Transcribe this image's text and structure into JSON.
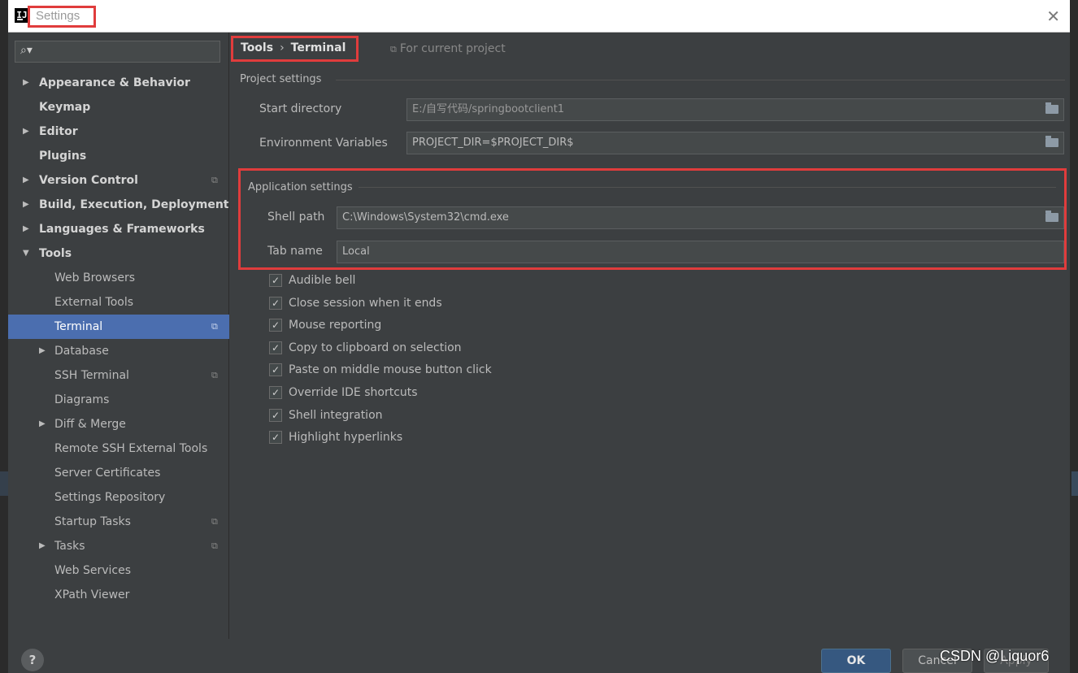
{
  "window": {
    "title": "Settings",
    "app_icon": "IJ",
    "close_symbol": "✕"
  },
  "search": {
    "icon": "⌕▾"
  },
  "sidebar": {
    "items": [
      {
        "label": "Appearance & Behavior",
        "arrow": "▶",
        "bold": true
      },
      {
        "label": "Keymap",
        "arrow": "",
        "bold": true
      },
      {
        "label": "Editor",
        "arrow": "▶",
        "bold": true
      },
      {
        "label": "Plugins",
        "arrow": "",
        "bold": true
      },
      {
        "label": "Version Control",
        "arrow": "▶",
        "bold": true,
        "copy_icon": true
      },
      {
        "label": "Build, Execution, Deployment",
        "arrow": "▶",
        "bold": true
      },
      {
        "label": "Languages & Frameworks",
        "arrow": "▶",
        "bold": true
      },
      {
        "label": "Tools",
        "arrow": "▼",
        "bold": true
      },
      {
        "label": "Web Browsers",
        "arrow": "",
        "bold": false
      },
      {
        "label": "External Tools",
        "arrow": "",
        "bold": false
      },
      {
        "label": "Terminal",
        "arrow": "",
        "bold": false,
        "copy_icon": true,
        "selected": true
      },
      {
        "label": "Database",
        "arrow": "▶",
        "bold": false
      },
      {
        "label": "SSH Terminal",
        "arrow": "",
        "bold": false,
        "copy_icon": true
      },
      {
        "label": "Diagrams",
        "arrow": "",
        "bold": false
      },
      {
        "label": "Diff & Merge",
        "arrow": "▶",
        "bold": false
      },
      {
        "label": "Remote SSH External Tools",
        "arrow": "",
        "bold": false
      },
      {
        "label": "Server Certificates",
        "arrow": "",
        "bold": false
      },
      {
        "label": "Settings Repository",
        "arrow": "",
        "bold": false
      },
      {
        "label": "Startup Tasks",
        "arrow": "",
        "bold": false,
        "copy_icon": true
      },
      {
        "label": "Tasks",
        "arrow": "▶",
        "bold": false,
        "copy_icon": true
      },
      {
        "label": "Web Services",
        "arrow": "",
        "bold": false
      },
      {
        "label": "XPath Viewer",
        "arrow": "",
        "bold": false
      }
    ],
    "copy_icon_glyph": "⧉"
  },
  "breadcrumb": {
    "parent": "Tools",
    "separator": "›",
    "current": "Terminal"
  },
  "scope": {
    "label": "For current project",
    "icon": "⧉"
  },
  "project_settings": {
    "title": "Project settings",
    "start_directory": {
      "label": "Start directory",
      "value": "E:/自写代码/springbootclient1"
    },
    "env_vars": {
      "label": "Environment Variables",
      "value": "PROJECT_DIR=$PROJECT_DIR$"
    }
  },
  "application_settings": {
    "title": "Application settings",
    "shell_path": {
      "label": "Shell path",
      "value": "C:\\Windows\\System32\\cmd.exe"
    },
    "tab_name": {
      "label": "Tab name",
      "value": "Local"
    }
  },
  "checkboxes": [
    {
      "label": "Audible bell",
      "checked": true
    },
    {
      "label": "Close session when it ends",
      "checked": true
    },
    {
      "label": "Mouse reporting",
      "checked": true
    },
    {
      "label": "Copy to clipboard on selection",
      "checked": true
    },
    {
      "label": "Paste on middle mouse button click",
      "checked": true
    },
    {
      "label": "Override IDE shortcuts",
      "checked": true
    },
    {
      "label": "Shell integration",
      "checked": true
    },
    {
      "label": "Highlight hyperlinks",
      "checked": true
    }
  ],
  "check_glyph": "✓",
  "buttons": {
    "help": "?",
    "ok": "OK",
    "cancel": "Cancel",
    "apply": "Apply"
  },
  "watermark": "CSDN @Liquor6",
  "colors": {
    "selection": "#4b6eaf",
    "highlight_box": "#e03c3c",
    "ok_button": "#365880",
    "panel": "#3c3f41"
  }
}
